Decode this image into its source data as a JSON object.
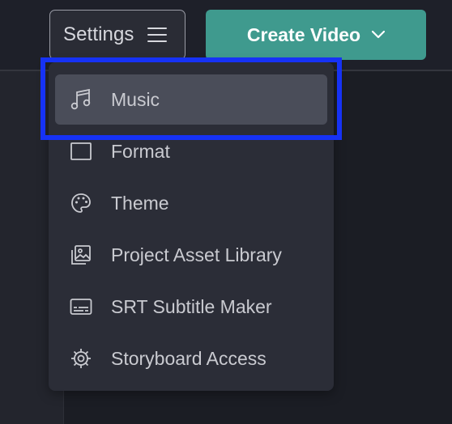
{
  "header": {
    "settings_label": "Settings",
    "create_video_label": "Create Video"
  },
  "menu": {
    "items": [
      {
        "label": "Music",
        "icon": "music-note-icon",
        "active": true
      },
      {
        "label": "Format",
        "icon": "square-frame-icon"
      },
      {
        "label": "Theme",
        "icon": "palette-icon"
      },
      {
        "label": "Project Asset Library",
        "icon": "image-library-icon"
      },
      {
        "label": "SRT Subtitle Maker",
        "icon": "subtitle-icon"
      },
      {
        "label": "Storyboard Access",
        "icon": "gear-icon"
      }
    ]
  },
  "colors": {
    "accent": "#3f9a8e",
    "highlight_outline": "#1632f5",
    "menu_background": "#2b2d37"
  }
}
